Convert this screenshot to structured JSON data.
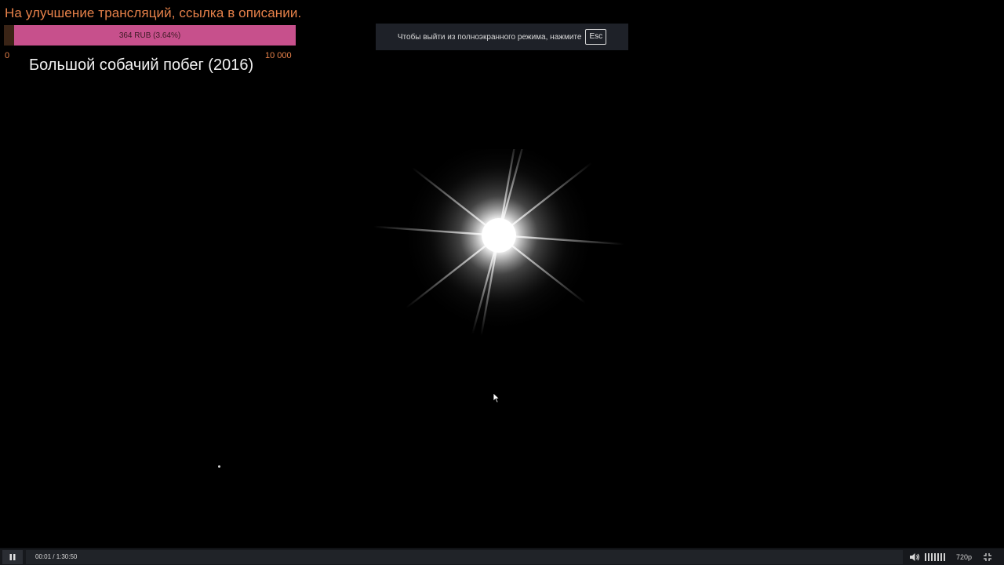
{
  "donation": {
    "title": "На улучшение трансляций, ссылка в описании.",
    "amount_text": "364 RUB (3.64%)",
    "progress_fraction": 0.0364,
    "min_label": "0",
    "max_label": "10 000",
    "bar_color": "#c7508c",
    "text_color": "#e8824a"
  },
  "movie": {
    "title": "Большой собачий побег (2016)"
  },
  "fullscreen_notice": {
    "text": "Чтобы выйти из полноэкранного режима, нажмите",
    "key": "Esc"
  },
  "player": {
    "pause_icon": "pause-icon",
    "time": "00:01 / 1:30:50",
    "volume_icon": "speaker-icon",
    "volume_level": 1.0,
    "quality": "720p",
    "fullscreen_icon": "fullscreen-exit-icon"
  }
}
